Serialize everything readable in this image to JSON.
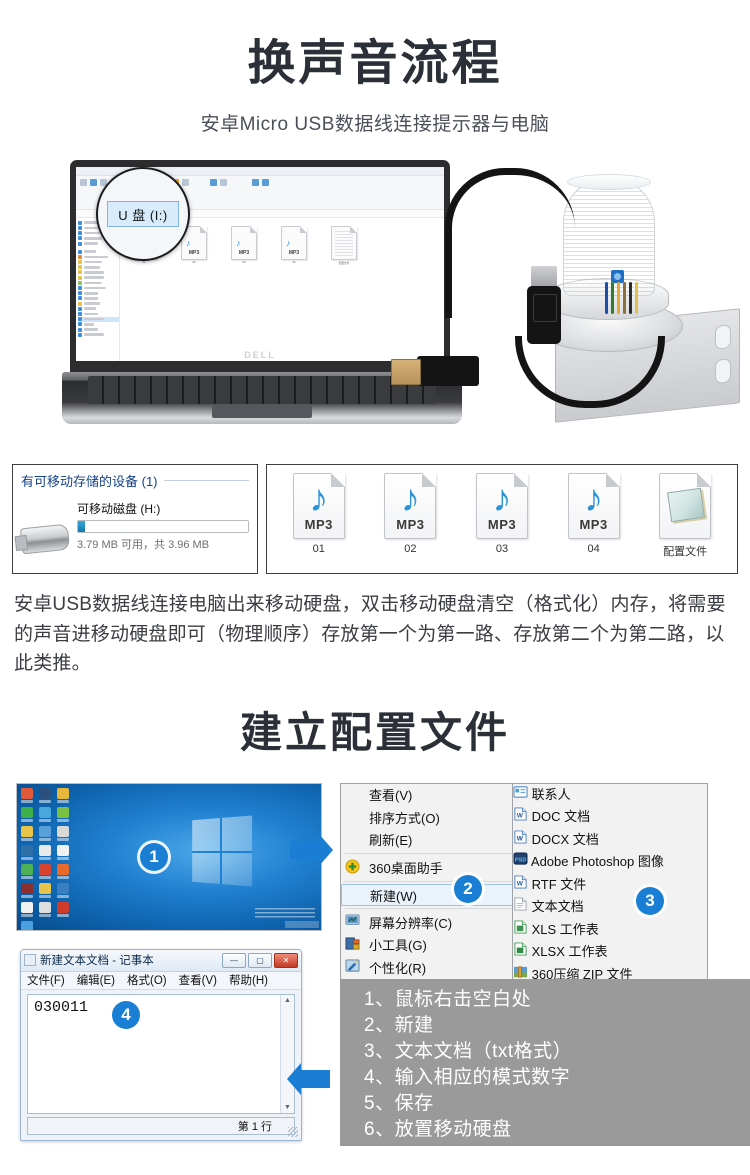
{
  "hero": {
    "title": "换声音流程",
    "subtitle": "安卓Micro USB数据线连接提示器与电脑"
  },
  "photo": {
    "laptop_brand": "DELL",
    "magnifier_label": "U 盘 (I:)",
    "explorer": {
      "files": [
        {
          "type": "mp3",
          "label": "01"
        },
        {
          "type": "mp3",
          "label": "02"
        },
        {
          "type": "mp3",
          "label": "03"
        },
        {
          "type": "mp3",
          "label": "04"
        },
        {
          "type": "txt",
          "label": "配置文件"
        }
      ],
      "mp3_badge": "MP3"
    }
  },
  "storage_panel": {
    "section_header": "有可移动存储的设备 (1)",
    "drive_name": "可移动磁盘",
    "drive_letter": "(H:)",
    "capacity_text": "3.79 MB 可用，共 3.96 MB",
    "used_percent": 4
  },
  "files_panel": {
    "items": [
      {
        "label": "01",
        "badge": "MP3",
        "kind": "mp3"
      },
      {
        "label": "02",
        "badge": "MP3",
        "kind": "mp3"
      },
      {
        "label": "03",
        "badge": "MP3",
        "kind": "mp3"
      },
      {
        "label": "04",
        "badge": "MP3",
        "kind": "mp3"
      },
      {
        "label": "配置文件",
        "badge": "",
        "kind": "notepad"
      }
    ]
  },
  "paragraph": "安卓USB数据线连接电脑出来移动硬盘，双击移动硬盘清空（格式化）内存，将需要的声音进移动硬盘即可（物理顺序）存放第一个为第一路、存放第二个为第二路，以此类推。",
  "section2": {
    "title": "建立配置文件",
    "badges": {
      "b1": "1",
      "b2": "2",
      "b3": "3",
      "b4": "4"
    },
    "context_menu": [
      {
        "label": "查看(V)",
        "submenu": true,
        "icon": "",
        "selected": false
      },
      {
        "label": "排序方式(O)",
        "submenu": true,
        "icon": "",
        "selected": false
      },
      {
        "label": "刷新(E)",
        "submenu": false,
        "icon": "",
        "selected": false
      },
      {
        "label": "360桌面助手",
        "submenu": true,
        "icon": "360-icon",
        "selected": false
      },
      {
        "label": "新建(W)",
        "submenu": true,
        "icon": "",
        "selected": true
      },
      {
        "label": "屏幕分辨率(C)",
        "submenu": false,
        "icon": "monitor-icon",
        "selected": false
      },
      {
        "label": "小工具(G)",
        "submenu": false,
        "icon": "gadget-icon",
        "selected": false
      },
      {
        "label": "个性化(R)",
        "submenu": false,
        "icon": "personalize-icon",
        "selected": false
      }
    ],
    "submenu": [
      {
        "label": "联系人",
        "icon": "contact-icon",
        "selected": false
      },
      {
        "label": "DOC 文档",
        "icon": "word-icon",
        "selected": false
      },
      {
        "label": "DOCX 文档",
        "icon": "word-icon",
        "selected": false
      },
      {
        "label": "Adobe Photoshop 图像",
        "icon": "psd-icon",
        "selected": false
      },
      {
        "label": "RTF 文件",
        "icon": "word-icon",
        "selected": false
      },
      {
        "label": "文本文档",
        "icon": "text-icon",
        "selected": true
      },
      {
        "label": "XLS 工作表",
        "icon": "excel-icon",
        "selected": false
      },
      {
        "label": "XLSX 工作表",
        "icon": "excel-icon",
        "selected": false
      },
      {
        "label": "360压缩 ZIP 文件",
        "icon": "zip-icon",
        "selected": false
      }
    ],
    "notepad": {
      "title": "新建文本文档 - 记事本",
      "menu": [
        "文件(F)",
        "编辑(E)",
        "格式(O)",
        "查看(V)",
        "帮助(H)"
      ],
      "content": "030011",
      "status": "第 1 行",
      "buttons": {
        "minimize": "—",
        "maximize": "▢",
        "close": "✕"
      }
    },
    "steps": [
      "1、鼠标右击空白处",
      "2、新建",
      "3、文本文档（txt格式）",
      "4、输入相应的模式数字",
      "5、保存",
      "6、放置移动硬盘"
    ]
  },
  "colors": {
    "badge_blue": "#1a7fd4",
    "title_dark": "#2b2f38",
    "steps_gray": "#9a9a9a",
    "section_header_blue": "#15428b"
  }
}
